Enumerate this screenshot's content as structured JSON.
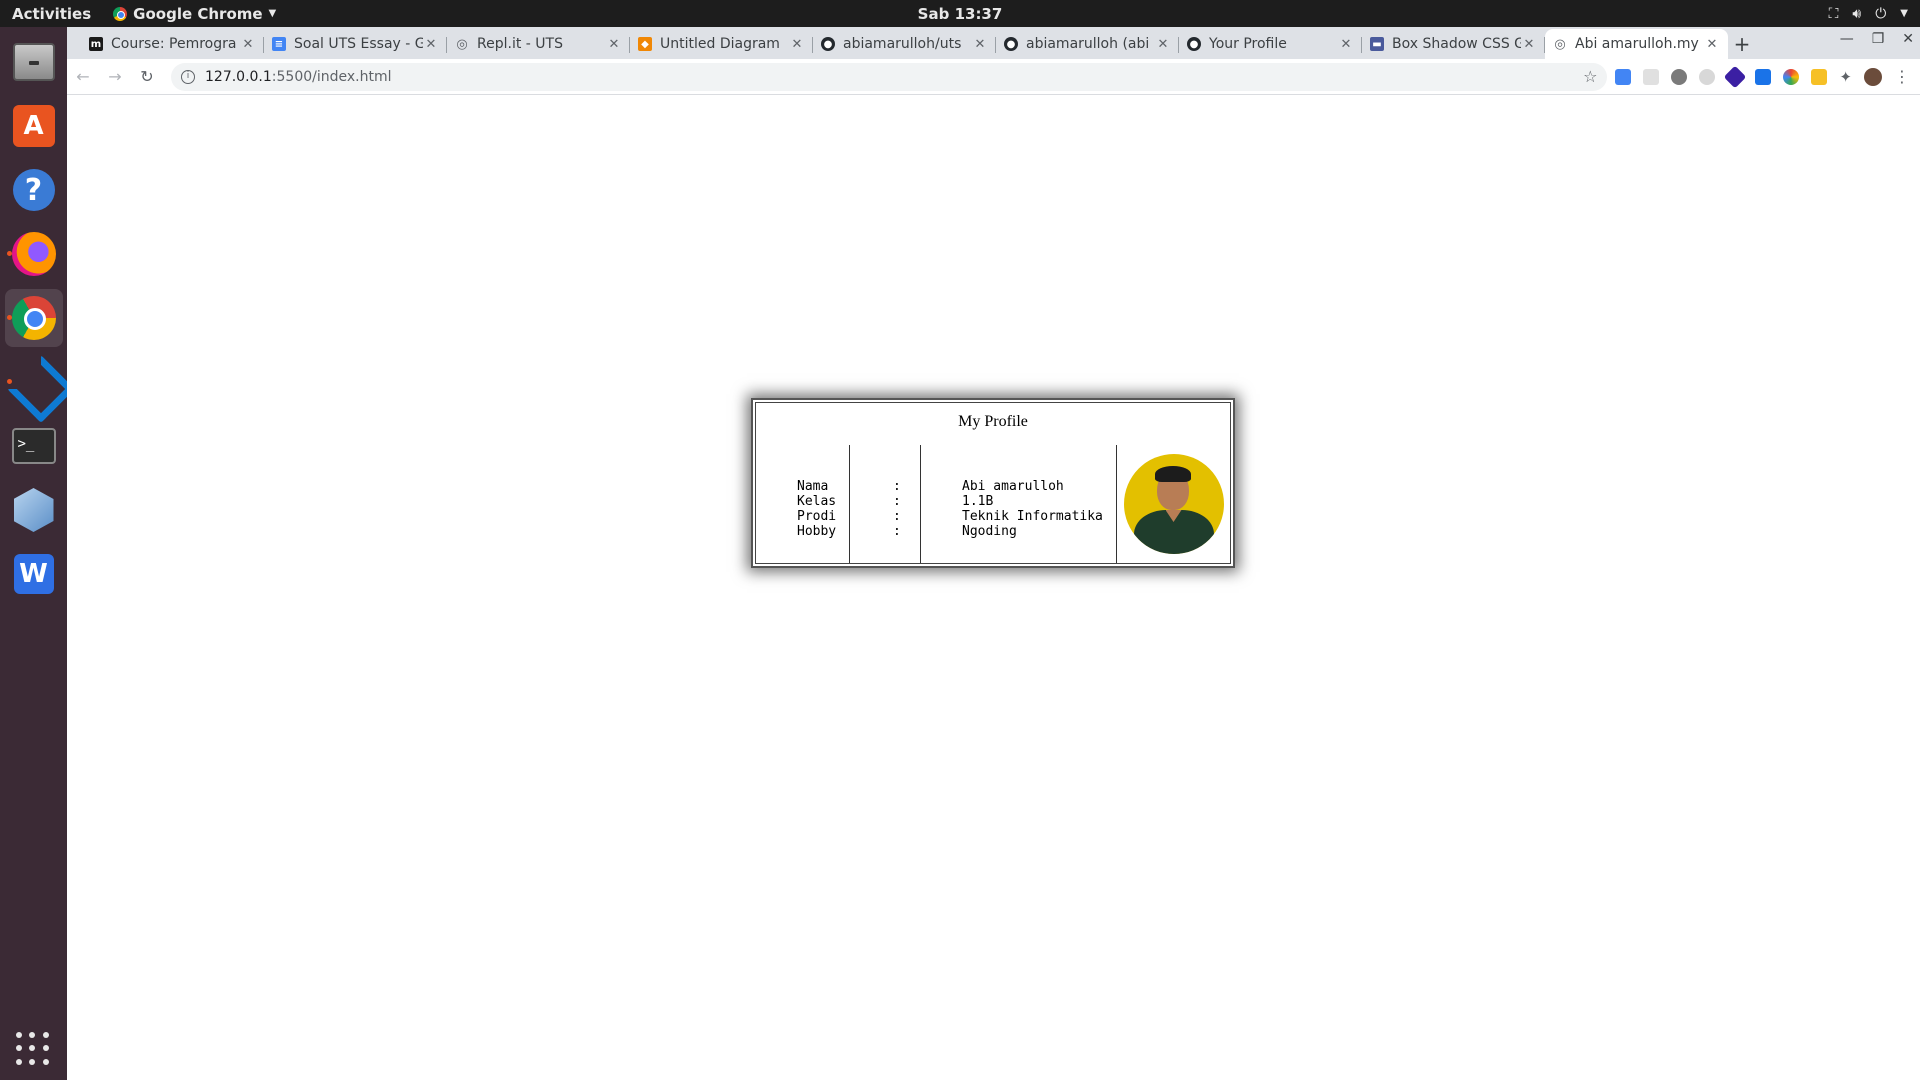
{
  "topbar": {
    "activities": "Activities",
    "app_name": "Google Chrome",
    "clock": "Sab 13:37"
  },
  "dock": {
    "items": [
      {
        "icon": "files-icon"
      },
      {
        "icon": "ubuntu-software-icon",
        "glyph": "A"
      },
      {
        "icon": "help-icon",
        "glyph": "?"
      },
      {
        "icon": "firefox-icon"
      },
      {
        "icon": "chrome-icon"
      },
      {
        "icon": "vscode-icon"
      },
      {
        "icon": "terminal-icon",
        "glyph": ">_"
      },
      {
        "icon": "virtualbox-icon"
      },
      {
        "icon": "wps-writer-icon",
        "glyph": "W"
      }
    ]
  },
  "browser": {
    "tabs": [
      {
        "title": "Course: Pemrogra",
        "favicon_color": "#1a1a1a",
        "favicon_glyph": "m"
      },
      {
        "title": "Soal UTS Essay - G",
        "favicon_color": "#4285f4",
        "favicon_glyph": "≡"
      },
      {
        "title": "Repl.it - UTS",
        "favicon_color": "#5f6368",
        "favicon_glyph": "◎"
      },
      {
        "title": "Untitled Diagram",
        "favicon_color": "#f08705",
        "favicon_glyph": "◆"
      },
      {
        "title": "abiamarulloh/uts",
        "favicon_color": "#24292e",
        "favicon_glyph": "●"
      },
      {
        "title": "abiamarulloh (abi",
        "favicon_color": "#24292e",
        "favicon_glyph": "●"
      },
      {
        "title": "Your Profile",
        "favicon_color": "#24292e",
        "favicon_glyph": "●"
      },
      {
        "title": "Box Shadow CSS G",
        "favicon_color": "#4a5a9c",
        "favicon_glyph": "▬"
      },
      {
        "title": "Abi amarulloh.my",
        "favicon_color": "#5f6368",
        "favicon_glyph": "◎"
      }
    ],
    "active_tab_index": 8,
    "url_host": "127.0.0.1",
    "url_path": ":5500/index.html"
  },
  "profile": {
    "title": "My Profile",
    "rows": [
      {
        "label": "Nama",
        "colon": ":",
        "value": "Abi amarulloh"
      },
      {
        "label": "Kelas",
        "colon": ":",
        "value": "1.1B"
      },
      {
        "label": "Prodi",
        "colon": ":",
        "value": "Teknik Informatika"
      },
      {
        "label": "Hobby",
        "colon": ":",
        "value": "Ngoding"
      }
    ],
    "photo_bg": "#e3c000"
  }
}
